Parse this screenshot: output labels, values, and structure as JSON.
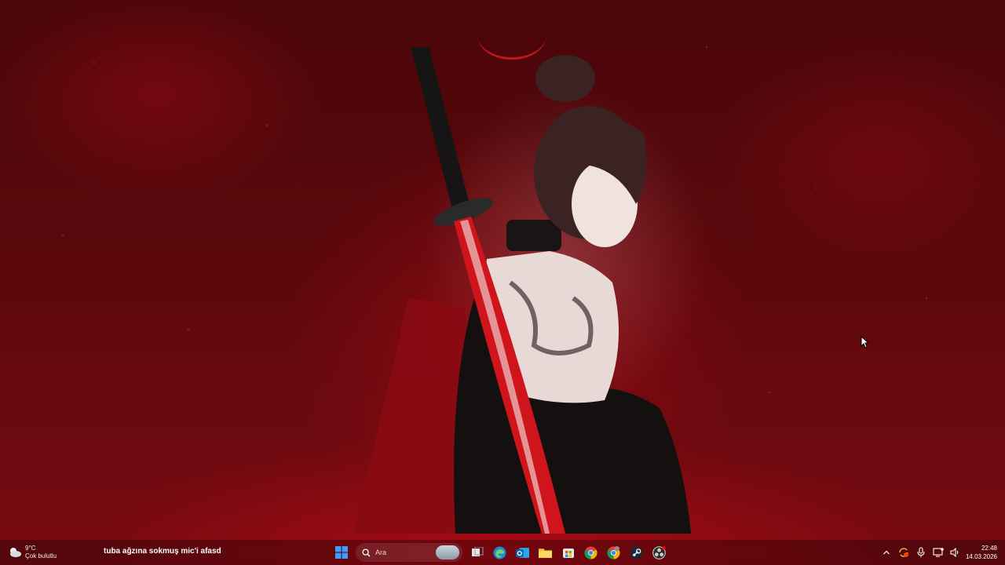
{
  "desktop": {
    "wallpaper": "red-samurai-girl-wallpaper"
  },
  "taskbar": {
    "weather": {
      "temperature": "9°C",
      "condition": "Çok bulutlu",
      "icon": "cloudy-weather-icon"
    },
    "news_ticker": "tuba ağzına sokmuş mic'i afasd",
    "search": {
      "placeholder": "Ara"
    },
    "pinned_apps": [
      {
        "name": "windows-start",
        "icon": "windows-logo-icon"
      },
      {
        "name": "task-view",
        "icon": "task-view-icon"
      },
      {
        "name": "edge",
        "icon": "edge-icon"
      },
      {
        "name": "outlook",
        "icon": "outlook-icon"
      },
      {
        "name": "file-explorer",
        "icon": "folder-icon"
      },
      {
        "name": "microsoft-store",
        "icon": "store-icon"
      },
      {
        "name": "chrome",
        "icon": "chrome-icon"
      },
      {
        "name": "chrome-profile",
        "icon": "chrome-icon"
      },
      {
        "name": "steam",
        "icon": "steam-icon"
      },
      {
        "name": "obs",
        "icon": "obs-icon"
      }
    ],
    "tray": {
      "icons": [
        "chevron-up-icon",
        "sync-icon",
        "microphone-icon",
        "display-icon",
        "speaker-icon"
      ]
    },
    "clock": {
      "time": "22:48",
      "date": "14.03.2026"
    }
  },
  "colors": {
    "accent": "#0078d4",
    "wallpaper_red": "#6d0a10"
  }
}
